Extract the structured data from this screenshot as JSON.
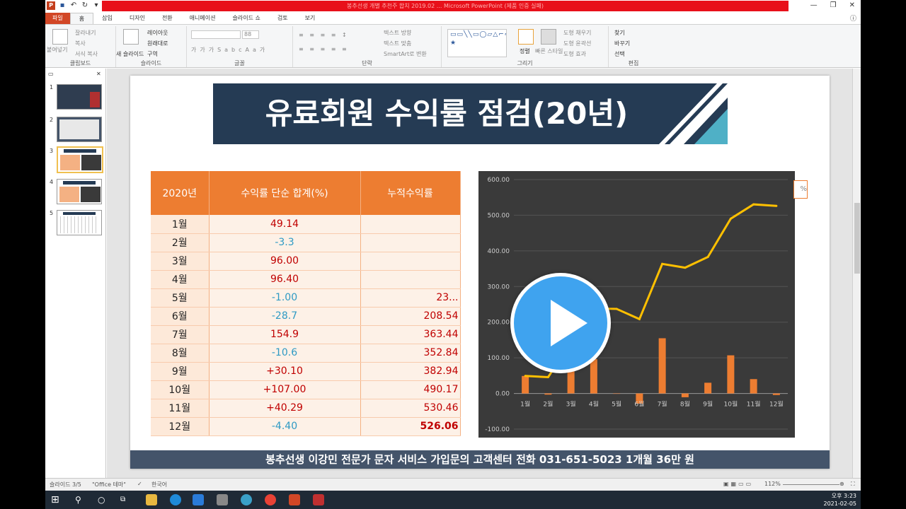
{
  "window": {
    "title": "봉추선생 개별 추천주 합치 2019.02 ... Microsoft PowerPoint (제품 인증 실패)",
    "minimize_icon": "minimize-icon",
    "restore_icon": "restore-icon",
    "close_icon": "close-icon"
  },
  "ribbon_tabs": [
    "파일",
    "홈",
    "삽입",
    "디자인",
    "전환",
    "애니메이션",
    "슬라이드 쇼",
    "검토",
    "보기"
  ],
  "ribbon": {
    "clipboard": {
      "paste": "붙여넣기",
      "cut": "잘라내기",
      "copy": "복사",
      "format_painter": "서식 복사",
      "label": "클립보드"
    },
    "slides": {
      "new_slide": "새 슬라이드",
      "layout": "레이아웃",
      "reset": "원래대로",
      "section": "구역",
      "label": "슬라이드"
    },
    "font": {
      "size": "88",
      "label": "글꼴"
    },
    "paragraph": {
      "label": "단락",
      "text_direction": "텍스트 방향",
      "align_text": "텍스트 맞춤",
      "smartart": "SmartArt로 변환"
    },
    "drawing": {
      "arrange": "정렬",
      "quick_styles": "빠른 스타일",
      "fill": "도형 채우기",
      "outline": "도형 윤곽선",
      "effects": "도형 효과",
      "label": "그리기"
    },
    "editing": {
      "find": "찾기",
      "replace": "바꾸기",
      "select": "선택",
      "label": "편집"
    }
  },
  "thumbnails": [
    "1",
    "2",
    "3",
    "4",
    "5"
  ],
  "slide": {
    "title": "유료회원 수익률 점검(20년)",
    "table": {
      "headers": [
        "2020년",
        "수익률 단순 합계(%)",
        "누적수익률"
      ],
      "rows": [
        {
          "month": "1월",
          "sum": "49.14",
          "cum": ""
        },
        {
          "month": "2월",
          "sum": "-3.3",
          "cum": ""
        },
        {
          "month": "3월",
          "sum": "96.00",
          "cum": ""
        },
        {
          "month": "4월",
          "sum": "96.40",
          "cum": ""
        },
        {
          "month": "5월",
          "sum": "-1.00",
          "cum": "23..."
        },
        {
          "month": "6월",
          "sum": "-28.7",
          "cum": "208.54"
        },
        {
          "month": "7월",
          "sum": "154.9",
          "cum": "363.44"
        },
        {
          "month": "8월",
          "sum": "-10.6",
          "cum": "352.84"
        },
        {
          "month": "9월",
          "sum": "+30.10",
          "cum": "382.94"
        },
        {
          "month": "10월",
          "sum": "+107.00",
          "cum": "490.17"
        },
        {
          "month": "11월",
          "sum": "+40.29",
          "cum": "530.46"
        },
        {
          "month": "12월",
          "sum": "-4.40",
          "cum": "526.06"
        }
      ]
    },
    "legend_fragment": "%",
    "footer": "봉추선생 이강민 전문가 문자 서비스 가입문의 고객센터  전화 031-651-5023  1개월 36만 원"
  },
  "chart_data": {
    "type": "bar",
    "categories": [
      "1월",
      "2월",
      "3월",
      "4월",
      "5월",
      "6월",
      "7월",
      "8월",
      "9월",
      "10월",
      "11월",
      "12월"
    ],
    "series": [
      {
        "type": "bar",
        "values": [
          49.14,
          -3.3,
          96.0,
          96.4,
          -1.0,
          -28.7,
          154.9,
          -10.6,
          30.1,
          107.0,
          40.29,
          -4.4
        ],
        "color": "#ed7d31"
      },
      {
        "type": "line",
        "values": [
          49.14,
          45.84,
          141.84,
          238.24,
          237.24,
          208.54,
          363.44,
          352.84,
          382.94,
          490.17,
          530.46,
          526.06
        ],
        "color": "#ffc000"
      }
    ],
    "ylim": [
      -100,
      600
    ],
    "yticks": [
      "600.00",
      "500.00",
      "400.00",
      "300.00",
      "200.00",
      "100.00",
      "0.00",
      "-100.00"
    ],
    "grid": true,
    "background": "#3a3a3a"
  },
  "status": {
    "slide": "슬라이드 3/5",
    "theme": "\"Office 테마\"",
    "language": "한국어",
    "zoom": "112%"
  },
  "clock": {
    "time": "오후 3:23",
    "date": "2021-02-05"
  }
}
